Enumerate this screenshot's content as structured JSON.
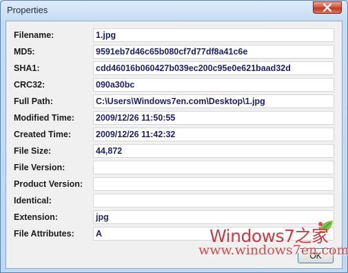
{
  "window": {
    "title": "Properties"
  },
  "fields": [
    {
      "label": "Filename:",
      "value": "1.jpg"
    },
    {
      "label": "MD5:",
      "value": "9591eb7d46c65b080cf7d77df8a41c6e"
    },
    {
      "label": "SHA1:",
      "value": "cdd46016b060427b039ec200c95e0e621baad32d"
    },
    {
      "label": "CRC32:",
      "value": "090a30bc"
    },
    {
      "label": "Full Path:",
      "value": "C:\\Users\\Windows7en.com\\Desktop\\1.jpg"
    },
    {
      "label": "Modified Time:",
      "value": "2009/12/26 11:50:55"
    },
    {
      "label": "Created Time:",
      "value": "2009/12/26 11:42:32"
    },
    {
      "label": "File Size:",
      "value": "44,872"
    },
    {
      "label": "File Version:",
      "value": ""
    },
    {
      "label": "Product Version:",
      "value": ""
    },
    {
      "label": "Identical:",
      "value": ""
    },
    {
      "label": "Extension:",
      "value": "jpg"
    },
    {
      "label": "File Attributes:",
      "value": "A"
    }
  ],
  "buttons": {
    "ok_label": "OK"
  },
  "watermark": {
    "line1": "Windows7之家",
    "line2": "www.windows7en.com"
  },
  "colors": {
    "value_text": "#1a1f6e",
    "close_button": "#c23a1f",
    "watermark": "#d2363f"
  },
  "icons": {
    "close": "close-x-icon",
    "watermark_leaf": "leaf-icon"
  }
}
